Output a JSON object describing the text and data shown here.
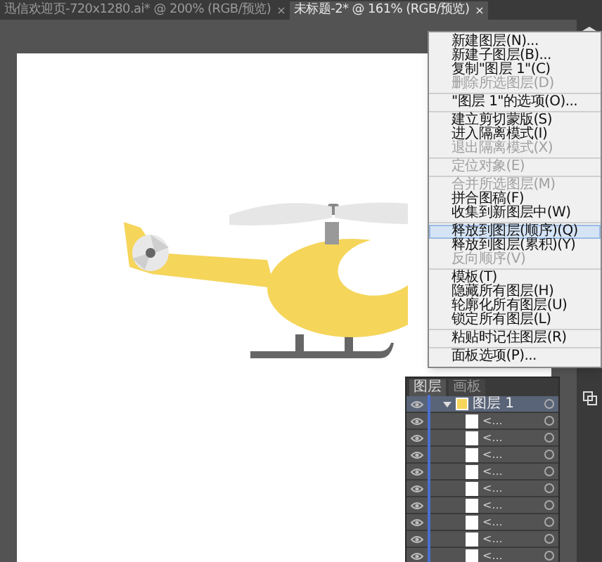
{
  "document_tabs": [
    {
      "label": "迅信欢迎页-720x1280.ai* @ 200% (RGB/预览)",
      "close": "×",
      "selected": false
    },
    {
      "label": "未标题-2* @ 161% (RGB/预览)",
      "close": "×",
      "selected": true
    }
  ],
  "layers_menu": [
    {
      "label": "新建图层(N)...",
      "disabled": false,
      "selected": false,
      "separator_after": false
    },
    {
      "label": "新建子图层(B)...",
      "disabled": false,
      "selected": false,
      "separator_after": false
    },
    {
      "label": "复制\"图层 1\"(C)",
      "disabled": false,
      "selected": false,
      "separator_after": false
    },
    {
      "label": "删除所选图层(D)",
      "disabled": true,
      "selected": false,
      "separator_after": true
    },
    {
      "label": "\"图层 1\"的选项(O)...",
      "disabled": false,
      "selected": false,
      "separator_after": true
    },
    {
      "label": "建立剪切蒙版(S)",
      "disabled": false,
      "selected": false,
      "separator_after": false
    },
    {
      "label": "进入隔离模式(I)",
      "disabled": false,
      "selected": false,
      "separator_after": false
    },
    {
      "label": "退出隔离模式(X)",
      "disabled": true,
      "selected": false,
      "separator_after": true
    },
    {
      "label": "定位对象(E)",
      "disabled": true,
      "selected": false,
      "separator_after": true
    },
    {
      "label": "合并所选图层(M)",
      "disabled": true,
      "selected": false,
      "separator_after": false
    },
    {
      "label": "拼合图稿(F)",
      "disabled": false,
      "selected": false,
      "separator_after": false
    },
    {
      "label": "收集到新图层中(W)",
      "disabled": false,
      "selected": false,
      "separator_after": true
    },
    {
      "label": "释放到图层(顺序)(Q)",
      "disabled": false,
      "selected": true,
      "separator_after": false
    },
    {
      "label": "释放到图层(累积)(Y)",
      "disabled": false,
      "selected": false,
      "separator_after": false
    },
    {
      "label": "反向顺序(V)",
      "disabled": true,
      "selected": false,
      "separator_after": true
    },
    {
      "label": "模板(T)",
      "disabled": false,
      "selected": false,
      "separator_after": false
    },
    {
      "label": "隐藏所有图层(H)",
      "disabled": false,
      "selected": false,
      "separator_after": false
    },
    {
      "label": "轮廓化所有图层(U)",
      "disabled": false,
      "selected": false,
      "separator_after": false
    },
    {
      "label": "锁定所有图层(L)",
      "disabled": false,
      "selected": false,
      "separator_after": true
    },
    {
      "label": "粘贴时记住图层(R)",
      "disabled": false,
      "selected": false,
      "separator_after": true
    },
    {
      "label": "面板选项(P)...",
      "disabled": false,
      "selected": false,
      "separator_after": false
    }
  ],
  "layers_panel": {
    "tabs": [
      {
        "label": "图层",
        "selected": true
      },
      {
        "label": "画板",
        "selected": false
      }
    ],
    "layers": [
      {
        "name": "图层 1",
        "expanded": true,
        "children": [
          {
            "name": "<..."
          },
          {
            "name": "<..."
          },
          {
            "name": "<..."
          },
          {
            "name": "<..."
          },
          {
            "name": "<..."
          },
          {
            "name": "<..."
          },
          {
            "name": "<..."
          },
          {
            "name": "<..."
          },
          {
            "name": "<..."
          }
        ]
      }
    ]
  }
}
